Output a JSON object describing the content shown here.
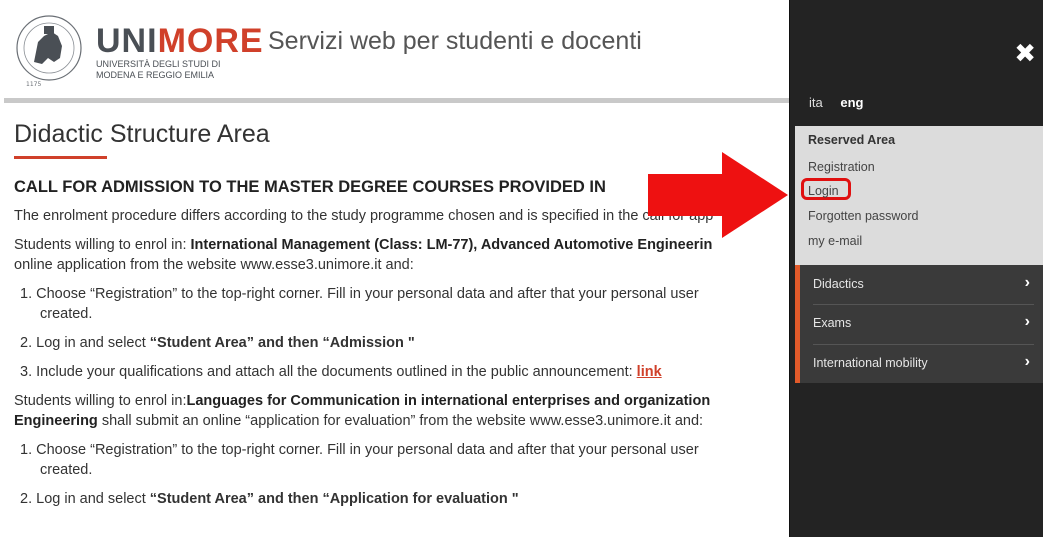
{
  "header": {
    "brand_uni": "UNI",
    "brand_more": "MORE",
    "brand_sub_line1": "UNIVERSITÀ DEGLI STUDI DI",
    "brand_sub_line2": "MODENA E REGGIO EMILIA",
    "title": "Servizi web per studenti e docenti"
  },
  "main": {
    "page_title": "Didactic Structure Area",
    "section_title": "CALL FOR ADMISSION TO THE MASTER DEGREE COURSES PROVIDED IN",
    "intro": "The enrolment procedure differs according to the study programme chosen and is specified in the call for app",
    "p1_pre": "Students willing to enrol in: ",
    "p1_bold": "International Management (Class: LM-77), Advanced Automotive Engineerin",
    "p1_line2": "online application from the website www.esse3.unimore.it and:",
    "list1": [
      {
        "num": "1.",
        "text": "Choose “Registration” to the top-right corner. Fill in your personal data and after that your personal user",
        "cont": "created."
      },
      {
        "num": "2.",
        "text_pre": "Log in and select ",
        "text_bold": "“Student Area” and then “Admission \""
      },
      {
        "num": "3.",
        "text_pre": "Include your qualifications and attach all the documents outlined in the public announcement: ",
        "link": "link"
      }
    ],
    "p2_pre": "Students willing to enrol in:",
    "p2_bold": "Languages for Communication in international enterprises and organization",
    "p2_bold2": "Engineering",
    "p2_rest": " shall submit an online “application for evaluation” from the website www.esse3.unimore.it and:",
    "list2": [
      {
        "num": "1.",
        "text": "Choose “Registration” to the top-right corner. Fill in your personal data and after that your personal user",
        "cont": "created."
      },
      {
        "num": "2.",
        "text_pre": "Log in and select ",
        "text_bold": "“Student Area” and then “Application for evaluation \""
      }
    ]
  },
  "panel": {
    "close_glyph": "✖",
    "lang_ita": "ita",
    "lang_eng": "eng",
    "reserved_head": "Reserved Area",
    "registration": "Registration",
    "login": "Login",
    "forgotten": "Forgotten password",
    "email": "my e-mail",
    "nav": [
      {
        "label": "Didactics",
        "chev": "›"
      },
      {
        "label": "Exams",
        "chev": "›"
      },
      {
        "label": "International mobility",
        "chev": "›"
      }
    ]
  },
  "colors": {
    "accent_red": "#d0402a",
    "panel_bg": "#232323",
    "highlight_red": "#e01010"
  }
}
